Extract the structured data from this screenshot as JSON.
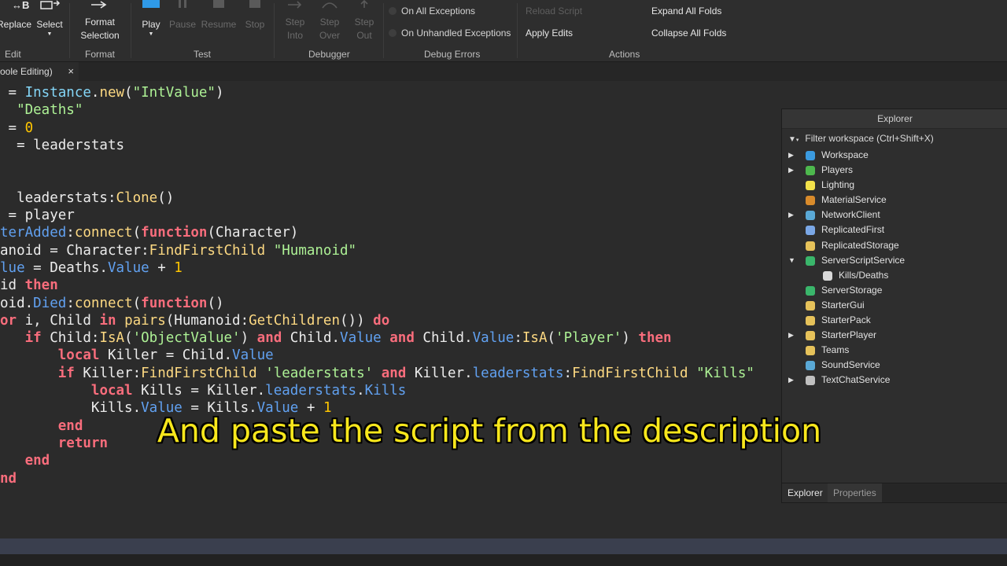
{
  "ribbon": {
    "buttons": {
      "replace": "Replace",
      "select": "Select",
      "format_selection": "Format Selection",
      "play": "Play",
      "pause": "Pause",
      "resume": "Resume",
      "stop": "Stop",
      "step_into": "Step Into",
      "step_over": "Step Over",
      "step_out": "Step Out"
    },
    "groups": {
      "edit": "Edit",
      "format": "Format",
      "test": "Test",
      "debugger": "Debugger",
      "debug_errors": "Debug Errors",
      "actions": "Actions"
    },
    "debug_errors": {
      "on_all": "On All Exceptions",
      "on_unhandled": "On Unhandled Exceptions"
    },
    "actions": {
      "reload_script": "Reload Script",
      "apply_edits": "Apply Edits",
      "expand_all": "Expand All Folds",
      "collapse_all": "Collapse All Folds"
    }
  },
  "tab": {
    "label": "oole Editing)",
    "close": "×"
  },
  "explorer": {
    "title": "Explorer",
    "filter_placeholder": "Filter workspace (Ctrl+Shift+X)",
    "items": [
      {
        "label": "Workspace",
        "expander": "▶",
        "indent": 0,
        "color": "#3b9be0"
      },
      {
        "label": "Players",
        "expander": "▶",
        "indent": 0,
        "color": "#4db84d"
      },
      {
        "label": "Lighting",
        "expander": "",
        "indent": 0,
        "color": "#f2e14a"
      },
      {
        "label": "MaterialService",
        "expander": "",
        "indent": 0,
        "color": "#d98b2b"
      },
      {
        "label": "NetworkClient",
        "expander": "▶",
        "indent": 0,
        "color": "#5aa9d6"
      },
      {
        "label": "ReplicatedFirst",
        "expander": "",
        "indent": 0,
        "color": "#7aa7e6"
      },
      {
        "label": "ReplicatedStorage",
        "expander": "",
        "indent": 0,
        "color": "#e6c25a"
      },
      {
        "label": "ServerScriptService",
        "expander": "▼",
        "indent": 0,
        "color": "#3ab66b"
      },
      {
        "label": "Kills/Deaths",
        "expander": "",
        "indent": 1,
        "color": "#d9d9d9"
      },
      {
        "label": "ServerStorage",
        "expander": "",
        "indent": 0,
        "color": "#3ab66b"
      },
      {
        "label": "StarterGui",
        "expander": "",
        "indent": 0,
        "color": "#e6c25a"
      },
      {
        "label": "StarterPack",
        "expander": "",
        "indent": 0,
        "color": "#e6c25a"
      },
      {
        "label": "StarterPlayer",
        "expander": "▶",
        "indent": 0,
        "color": "#e6c25a"
      },
      {
        "label": "Teams",
        "expander": "",
        "indent": 0,
        "color": "#e6c25a"
      },
      {
        "label": "SoundService",
        "expander": "",
        "indent": 0,
        "color": "#5aa9d6"
      },
      {
        "label": "TextChatService",
        "expander": "▶",
        "indent": 0,
        "color": "#c0c0c0"
      }
    ],
    "tabs": {
      "explorer": "Explorer",
      "properties": "Properties"
    }
  },
  "code_lines": [
    [
      [
        "t",
        " = "
      ],
      [
        "bi",
        "Instance"
      ],
      [
        "t",
        "."
      ],
      [
        "fn",
        "new"
      ],
      [
        "t",
        "("
      ],
      [
        "st",
        "\"IntValue\""
      ],
      [
        "t",
        ")"
      ]
    ],
    [
      [
        "st",
        "  \"Deaths\""
      ]
    ],
    [
      [
        "t",
        " = "
      ],
      [
        "nm",
        "0"
      ]
    ],
    [
      [
        "t",
        "  = leaderstats"
      ]
    ],
    [
      [
        "t",
        ""
      ]
    ],
    [
      [
        "t",
        ""
      ]
    ],
    [
      [
        "t",
        "  leaderstats:"
      ],
      [
        "fn",
        "Clone"
      ],
      [
        "t",
        "()"
      ]
    ],
    [
      [
        "t",
        " = player"
      ]
    ],
    [
      [
        "pr",
        "terAdded"
      ],
      [
        "t",
        ":"
      ],
      [
        "fn",
        "connect"
      ],
      [
        "t",
        "("
      ],
      [
        "kw",
        "function"
      ],
      [
        "t",
        "(Character)"
      ]
    ],
    [
      [
        "t",
        "anoid = Character:"
      ],
      [
        "fn",
        "FindFirstChild"
      ],
      [
        "t",
        " "
      ],
      [
        "st",
        "\"Humanoid\""
      ]
    ],
    [
      [
        "pr",
        "lue"
      ],
      [
        "t",
        " = Deaths."
      ],
      [
        "pr",
        "Value"
      ],
      [
        "t",
        " + "
      ],
      [
        "nm",
        "1"
      ]
    ],
    [
      [
        "t",
        "id "
      ],
      [
        "kw",
        "then"
      ]
    ],
    [
      [
        "t",
        "oid."
      ],
      [
        "pr",
        "Died"
      ],
      [
        "t",
        ":"
      ],
      [
        "fn",
        "connect"
      ],
      [
        "t",
        "("
      ],
      [
        "kw",
        "function"
      ],
      [
        "t",
        "()"
      ]
    ],
    [
      [
        "kw",
        "or"
      ],
      [
        "t",
        " i, Child "
      ],
      [
        "kw",
        "in"
      ],
      [
        "t",
        " "
      ],
      [
        "fn",
        "pairs"
      ],
      [
        "t",
        "(Humanoid:"
      ],
      [
        "fn",
        "GetChildren"
      ],
      [
        "t",
        "()) "
      ],
      [
        "kw",
        "do"
      ]
    ],
    [
      [
        "t",
        "   "
      ],
      [
        "kw",
        "if"
      ],
      [
        "t",
        " Child:"
      ],
      [
        "fn",
        "IsA"
      ],
      [
        "t",
        "("
      ],
      [
        "st",
        "'ObjectValue'"
      ],
      [
        "t",
        ") "
      ],
      [
        "kw",
        "and"
      ],
      [
        "t",
        " Child."
      ],
      [
        "pr",
        "Value"
      ],
      [
        "t",
        " "
      ],
      [
        "kw",
        "and"
      ],
      [
        "t",
        " Child."
      ],
      [
        "pr",
        "Value"
      ],
      [
        "t",
        ":"
      ],
      [
        "fn",
        "IsA"
      ],
      [
        "t",
        "("
      ],
      [
        "st",
        "'Player'"
      ],
      [
        "t",
        ") "
      ],
      [
        "kw",
        "then"
      ]
    ],
    [
      [
        "t",
        "       "
      ],
      [
        "kw",
        "local"
      ],
      [
        "t",
        " Killer = Child."
      ],
      [
        "pr",
        "Value"
      ]
    ],
    [
      [
        "t",
        "       "
      ],
      [
        "kw",
        "if"
      ],
      [
        "t",
        " Killer:"
      ],
      [
        "fn",
        "FindFirstChild"
      ],
      [
        "t",
        " "
      ],
      [
        "st",
        "'leaderstats'"
      ],
      [
        "t",
        " "
      ],
      [
        "kw",
        "and"
      ],
      [
        "t",
        " Killer."
      ],
      [
        "pr",
        "leaderstats"
      ],
      [
        "t",
        ":"
      ],
      [
        "fn",
        "FindFirstChild"
      ],
      [
        "t",
        " "
      ],
      [
        "st",
        "\"Kills\""
      ]
    ],
    [
      [
        "t",
        "           "
      ],
      [
        "kw",
        "local"
      ],
      [
        "t",
        " Kills = Killer."
      ],
      [
        "pr",
        "leaderstats"
      ],
      [
        "t",
        "."
      ],
      [
        "pr",
        "Kills"
      ]
    ],
    [
      [
        "t",
        "           Kills."
      ],
      [
        "pr",
        "Value"
      ],
      [
        "t",
        " = Kills."
      ],
      [
        "pr",
        "Value"
      ],
      [
        "t",
        " + "
      ],
      [
        "nm",
        "1"
      ]
    ],
    [
      [
        "t",
        "       "
      ],
      [
        "kw",
        "end"
      ]
    ],
    [
      [
        "t",
        "       "
      ],
      [
        "kw",
        "return"
      ]
    ],
    [
      [
        "t",
        "   "
      ],
      [
        "kw",
        "end"
      ]
    ],
    [
      [
        "kw",
        "nd"
      ]
    ]
  ],
  "caption": "And paste the script from the description"
}
